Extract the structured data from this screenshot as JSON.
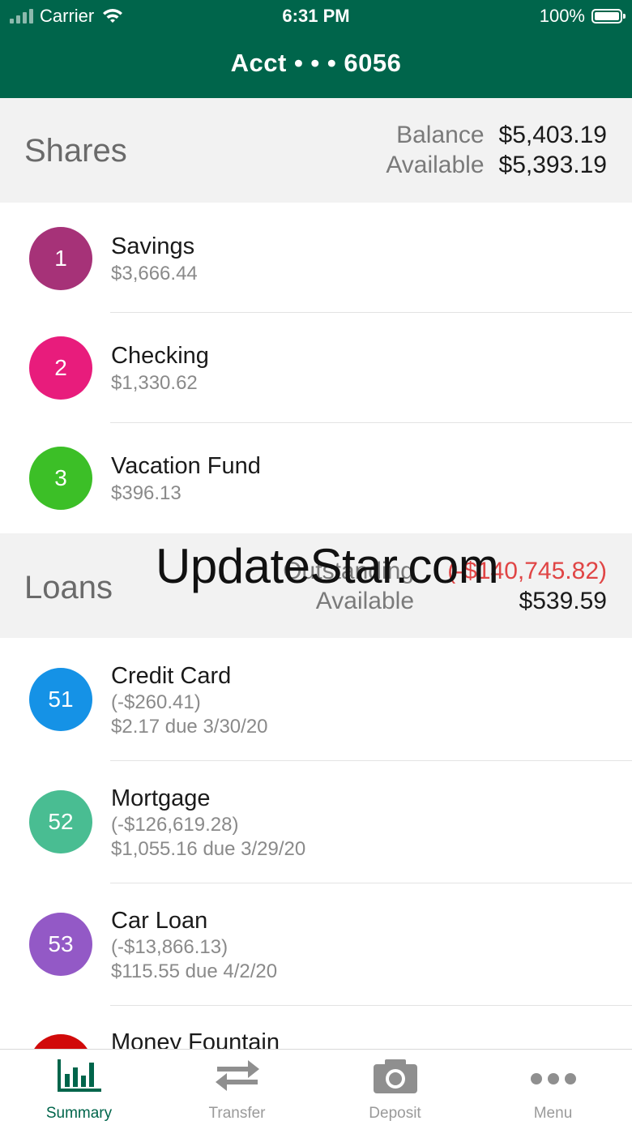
{
  "status_bar": {
    "carrier": "Carrier",
    "time": "6:31 PM",
    "battery": "100%"
  },
  "header": {
    "title": "Acct • • • 6056"
  },
  "shares": {
    "title": "Shares",
    "balance_label": "Balance",
    "balance_value": "$5,403.19",
    "available_label": "Available",
    "available_value": "$5,393.19",
    "accounts": [
      {
        "number": "1",
        "name": "Savings",
        "balance": "$3,666.44",
        "color": "#a63278"
      },
      {
        "number": "2",
        "name": "Checking",
        "balance": "$1,330.62",
        "color": "#e81c7c"
      },
      {
        "number": "3",
        "name": "Vacation Fund",
        "balance": "$396.13",
        "color": "#3cbf27"
      }
    ]
  },
  "loans": {
    "title": "Loans",
    "outstanding_label": "Outstanding",
    "outstanding_value": "(-$140,745.82)",
    "available_label": "Available",
    "available_value": "$539.59",
    "accounts": [
      {
        "number": "51",
        "name": "Credit Card",
        "balance": "(-$260.41)",
        "due": "$2.17 due 3/30/20",
        "color": "#1592e6"
      },
      {
        "number": "52",
        "name": "Mortgage",
        "balance": "(-$126,619.28)",
        "due": "$1,055.16 due 3/29/20",
        "color": "#49bd92"
      },
      {
        "number": "53",
        "name": "Car Loan",
        "balance": "(-$13,866.13)",
        "due": "$115.55 due 4/2/20",
        "color": "#9359c6"
      },
      {
        "number": "",
        "name": "Money Fountain",
        "color": "#d10a0a"
      }
    ]
  },
  "watermark": "UpdateStar.com",
  "tabbar": {
    "tabs": [
      {
        "label": "Summary",
        "icon": "bar-chart-icon"
      },
      {
        "label": "Transfer",
        "icon": "transfer-arrows-icon"
      },
      {
        "label": "Deposit",
        "icon": "camera-icon"
      },
      {
        "label": "Menu",
        "icon": "more-dots-icon"
      }
    ]
  },
  "colors": {
    "brand_green": "#00654b",
    "negative": "#e04545",
    "inactive_tab": "#9a9a9a"
  }
}
